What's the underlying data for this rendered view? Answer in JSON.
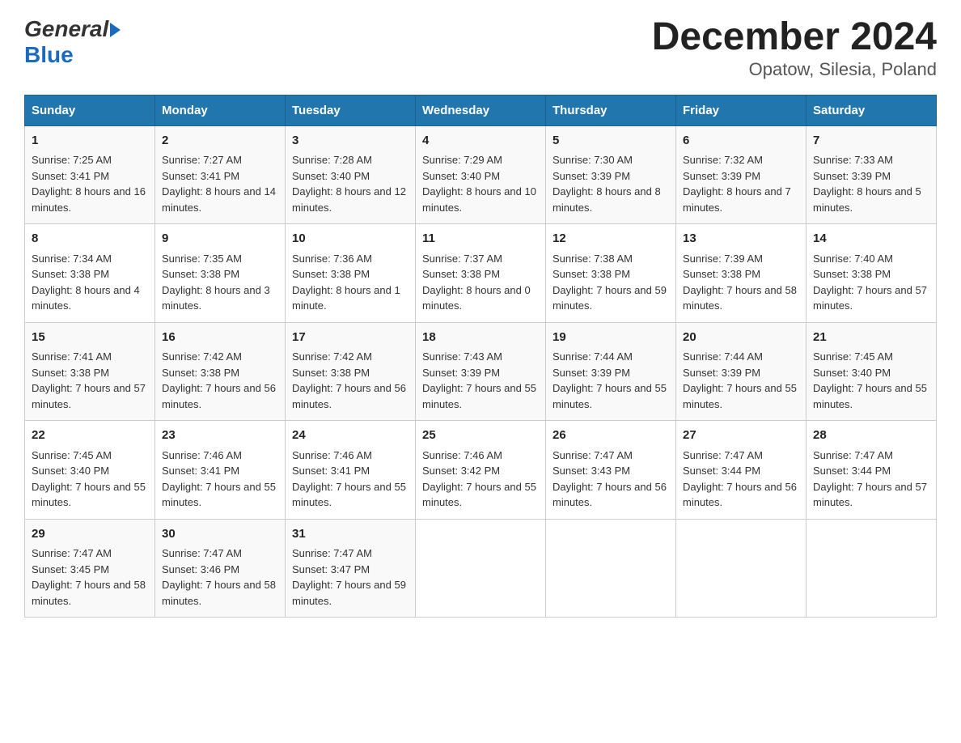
{
  "header": {
    "title": "December 2024",
    "subtitle": "Opatow, Silesia, Poland",
    "logo_general": "General",
    "logo_blue": "Blue"
  },
  "days_of_week": [
    "Sunday",
    "Monday",
    "Tuesday",
    "Wednesday",
    "Thursday",
    "Friday",
    "Saturday"
  ],
  "weeks": [
    [
      {
        "day": "1",
        "sunrise": "Sunrise: 7:25 AM",
        "sunset": "Sunset: 3:41 PM",
        "daylight": "Daylight: 8 hours and 16 minutes."
      },
      {
        "day": "2",
        "sunrise": "Sunrise: 7:27 AM",
        "sunset": "Sunset: 3:41 PM",
        "daylight": "Daylight: 8 hours and 14 minutes."
      },
      {
        "day": "3",
        "sunrise": "Sunrise: 7:28 AM",
        "sunset": "Sunset: 3:40 PM",
        "daylight": "Daylight: 8 hours and 12 minutes."
      },
      {
        "day": "4",
        "sunrise": "Sunrise: 7:29 AM",
        "sunset": "Sunset: 3:40 PM",
        "daylight": "Daylight: 8 hours and 10 minutes."
      },
      {
        "day": "5",
        "sunrise": "Sunrise: 7:30 AM",
        "sunset": "Sunset: 3:39 PM",
        "daylight": "Daylight: 8 hours and 8 minutes."
      },
      {
        "day": "6",
        "sunrise": "Sunrise: 7:32 AM",
        "sunset": "Sunset: 3:39 PM",
        "daylight": "Daylight: 8 hours and 7 minutes."
      },
      {
        "day": "7",
        "sunrise": "Sunrise: 7:33 AM",
        "sunset": "Sunset: 3:39 PM",
        "daylight": "Daylight: 8 hours and 5 minutes."
      }
    ],
    [
      {
        "day": "8",
        "sunrise": "Sunrise: 7:34 AM",
        "sunset": "Sunset: 3:38 PM",
        "daylight": "Daylight: 8 hours and 4 minutes."
      },
      {
        "day": "9",
        "sunrise": "Sunrise: 7:35 AM",
        "sunset": "Sunset: 3:38 PM",
        "daylight": "Daylight: 8 hours and 3 minutes."
      },
      {
        "day": "10",
        "sunrise": "Sunrise: 7:36 AM",
        "sunset": "Sunset: 3:38 PM",
        "daylight": "Daylight: 8 hours and 1 minute."
      },
      {
        "day": "11",
        "sunrise": "Sunrise: 7:37 AM",
        "sunset": "Sunset: 3:38 PM",
        "daylight": "Daylight: 8 hours and 0 minutes."
      },
      {
        "day": "12",
        "sunrise": "Sunrise: 7:38 AM",
        "sunset": "Sunset: 3:38 PM",
        "daylight": "Daylight: 7 hours and 59 minutes."
      },
      {
        "day": "13",
        "sunrise": "Sunrise: 7:39 AM",
        "sunset": "Sunset: 3:38 PM",
        "daylight": "Daylight: 7 hours and 58 minutes."
      },
      {
        "day": "14",
        "sunrise": "Sunrise: 7:40 AM",
        "sunset": "Sunset: 3:38 PM",
        "daylight": "Daylight: 7 hours and 57 minutes."
      }
    ],
    [
      {
        "day": "15",
        "sunrise": "Sunrise: 7:41 AM",
        "sunset": "Sunset: 3:38 PM",
        "daylight": "Daylight: 7 hours and 57 minutes."
      },
      {
        "day": "16",
        "sunrise": "Sunrise: 7:42 AM",
        "sunset": "Sunset: 3:38 PM",
        "daylight": "Daylight: 7 hours and 56 minutes."
      },
      {
        "day": "17",
        "sunrise": "Sunrise: 7:42 AM",
        "sunset": "Sunset: 3:38 PM",
        "daylight": "Daylight: 7 hours and 56 minutes."
      },
      {
        "day": "18",
        "sunrise": "Sunrise: 7:43 AM",
        "sunset": "Sunset: 3:39 PM",
        "daylight": "Daylight: 7 hours and 55 minutes."
      },
      {
        "day": "19",
        "sunrise": "Sunrise: 7:44 AM",
        "sunset": "Sunset: 3:39 PM",
        "daylight": "Daylight: 7 hours and 55 minutes."
      },
      {
        "day": "20",
        "sunrise": "Sunrise: 7:44 AM",
        "sunset": "Sunset: 3:39 PM",
        "daylight": "Daylight: 7 hours and 55 minutes."
      },
      {
        "day": "21",
        "sunrise": "Sunrise: 7:45 AM",
        "sunset": "Sunset: 3:40 PM",
        "daylight": "Daylight: 7 hours and 55 minutes."
      }
    ],
    [
      {
        "day": "22",
        "sunrise": "Sunrise: 7:45 AM",
        "sunset": "Sunset: 3:40 PM",
        "daylight": "Daylight: 7 hours and 55 minutes."
      },
      {
        "day": "23",
        "sunrise": "Sunrise: 7:46 AM",
        "sunset": "Sunset: 3:41 PM",
        "daylight": "Daylight: 7 hours and 55 minutes."
      },
      {
        "day": "24",
        "sunrise": "Sunrise: 7:46 AM",
        "sunset": "Sunset: 3:41 PM",
        "daylight": "Daylight: 7 hours and 55 minutes."
      },
      {
        "day": "25",
        "sunrise": "Sunrise: 7:46 AM",
        "sunset": "Sunset: 3:42 PM",
        "daylight": "Daylight: 7 hours and 55 minutes."
      },
      {
        "day": "26",
        "sunrise": "Sunrise: 7:47 AM",
        "sunset": "Sunset: 3:43 PM",
        "daylight": "Daylight: 7 hours and 56 minutes."
      },
      {
        "day": "27",
        "sunrise": "Sunrise: 7:47 AM",
        "sunset": "Sunset: 3:44 PM",
        "daylight": "Daylight: 7 hours and 56 minutes."
      },
      {
        "day": "28",
        "sunrise": "Sunrise: 7:47 AM",
        "sunset": "Sunset: 3:44 PM",
        "daylight": "Daylight: 7 hours and 57 minutes."
      }
    ],
    [
      {
        "day": "29",
        "sunrise": "Sunrise: 7:47 AM",
        "sunset": "Sunset: 3:45 PM",
        "daylight": "Daylight: 7 hours and 58 minutes."
      },
      {
        "day": "30",
        "sunrise": "Sunrise: 7:47 AM",
        "sunset": "Sunset: 3:46 PM",
        "daylight": "Daylight: 7 hours and 58 minutes."
      },
      {
        "day": "31",
        "sunrise": "Sunrise: 7:47 AM",
        "sunset": "Sunset: 3:47 PM",
        "daylight": "Daylight: 7 hours and 59 minutes."
      },
      null,
      null,
      null,
      null
    ]
  ]
}
